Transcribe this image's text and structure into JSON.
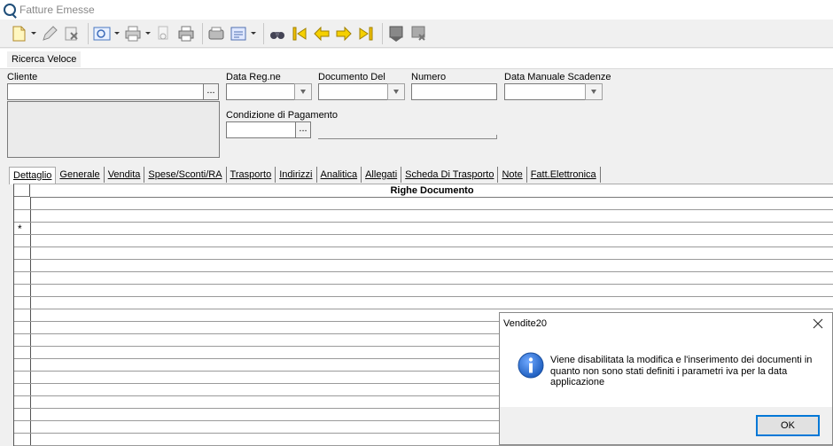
{
  "window": {
    "title": "Fatture Emesse",
    "app_icon": "search-app-icon"
  },
  "toolbar": {
    "buttons": [
      {
        "name": "new-document-icon"
      },
      {
        "name": "edit-pencil-icon"
      },
      {
        "name": "delete-icon"
      },
      {
        "name": "preview-icon"
      },
      {
        "name": "print-icon"
      },
      {
        "name": "print-preview-icon"
      },
      {
        "name": "printer-icon"
      },
      {
        "name": "fax-icon"
      },
      {
        "name": "report-icon"
      },
      {
        "name": "binoculars-icon"
      },
      {
        "name": "first-record-icon"
      },
      {
        "name": "previous-record-icon"
      },
      {
        "name": "next-record-icon"
      },
      {
        "name": "last-record-icon"
      },
      {
        "name": "save-icon"
      },
      {
        "name": "cancel-save-icon"
      }
    ]
  },
  "quick_search": {
    "label": "Ricerca Veloce"
  },
  "form": {
    "cliente_label": "Cliente",
    "cliente_value": "",
    "data_reg_label": "Data Reg.ne",
    "documento_del_label": "Documento Del",
    "numero_label": "Numero",
    "numero_value": "",
    "data_scadenze_label": "Data Manuale Scadenze",
    "condizione_label": "Condizione di Pagamento",
    "dots_label": "..."
  },
  "tabs": [
    {
      "label": "Dettaglio",
      "active": true
    },
    {
      "label": "Generale"
    },
    {
      "label": "Vendita"
    },
    {
      "label": "Spese/Sconti/RA"
    },
    {
      "label": "Trasporto"
    },
    {
      "label": "Indirizzi"
    },
    {
      "label": "Analitica"
    },
    {
      "label": "Allegati"
    },
    {
      "label": "Scheda Di Trasporto"
    },
    {
      "label": "Note"
    },
    {
      "label": "Fatt.Elettronica"
    }
  ],
  "grid": {
    "header": "Righe Documento",
    "new_row_marker": "*"
  },
  "dialog": {
    "title": "Vendite20",
    "message": "Viene disabilitata la modifica e l'inserimento dei documenti in quanto non sono stati definiti i parametri iva per la data applicazione",
    "ok_label": "OK",
    "colors": {
      "info_blue": "#1f5fbf",
      "ok_border": "#0078d7"
    }
  }
}
